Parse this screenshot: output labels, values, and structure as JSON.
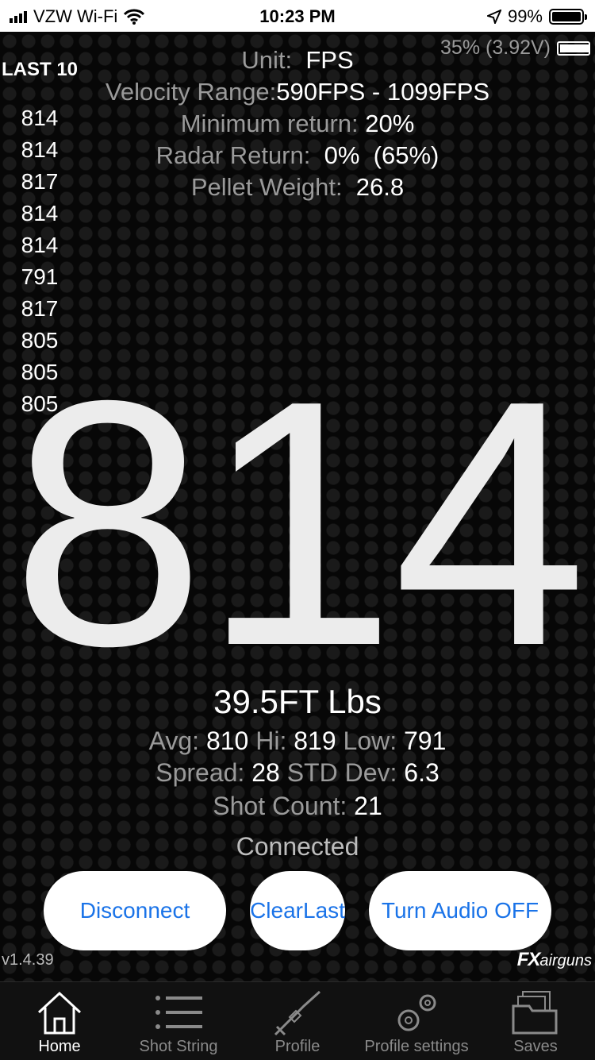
{
  "status_bar": {
    "carrier": "VZW Wi-Fi",
    "time": "10:23 PM",
    "battery": "99%",
    "icons": [
      "signal-icon",
      "wifi-icon",
      "location-arrow-icon",
      "battery-icon"
    ]
  },
  "device_battery": "35% (3.92V)",
  "last10": {
    "title": "LAST 10",
    "values": [
      "814",
      "814",
      "817",
      "814",
      "814",
      "791",
      "817",
      "805",
      "805",
      "805"
    ]
  },
  "settings": {
    "unit_label": "Unit:",
    "unit_value": "FPS",
    "velocity_label": "Velocity Range:",
    "velocity_value": "590FPS - 1099FPS",
    "min_return_label": "Minimum return:",
    "min_return_value": "20%",
    "radar_label": "Radar Return:",
    "radar_value": "0%  (65%)",
    "pellet_label": "Pellet Weight:",
    "pellet_value": "26.8"
  },
  "current_velocity": "814",
  "energy": "39.5FT Lbs",
  "stats": {
    "avg_label": "Avg:",
    "avg": "810",
    "hi_label": "Hi:",
    "hi": "819",
    "low_label": "Low:",
    "low": "791",
    "spread_label": "Spread:",
    "spread": "28",
    "std_label": "STD Dev:",
    "std": "6.3",
    "count_label": "Shot Count:",
    "count": "21"
  },
  "connection_status": "Connected",
  "buttons": {
    "disconnect": "Disconnect",
    "clear_line1": "Clear",
    "clear_line2": "Last",
    "audio": "Turn Audio OFF"
  },
  "version": "v1.4.39",
  "brand": {
    "fx": "FX",
    "name": "airguns"
  },
  "tabs": [
    {
      "label": "Home",
      "icon": "home-icon"
    },
    {
      "label": "Shot String",
      "icon": "list-icon"
    },
    {
      "label": "Profile",
      "icon": "rifle-icon"
    },
    {
      "label": "Profile settings",
      "icon": "gears-icon"
    },
    {
      "label": "Saves",
      "icon": "folder-icon"
    }
  ],
  "colors": {
    "accent": "#1a73e8",
    "background": "#070707",
    "muted_text": "#9a9a9a"
  }
}
